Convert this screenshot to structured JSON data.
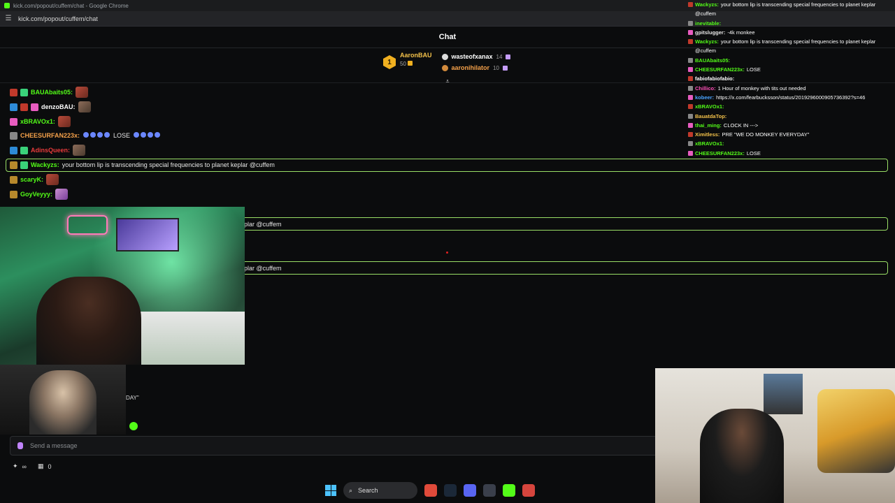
{
  "browser": {
    "title": "kick.com/popout/cuffem/chat - Google Chrome",
    "url": "kick.com/popout/cuffem/chat"
  },
  "chat": {
    "header": "Chat",
    "leaderboard": {
      "top": {
        "rank": "1",
        "name": "AaronBAU",
        "value": "50"
      },
      "others": [
        {
          "name": "wasteofxanax",
          "value": "14"
        },
        {
          "name": "aaronihilator",
          "value": "10"
        }
      ]
    },
    "messages": [
      {
        "user": "BAUAbaits05:",
        "text": "",
        "color": "#53fc18"
      },
      {
        "user": "denzoBAU:",
        "text": "",
        "color": "#ffffff"
      },
      {
        "user": "xBRAVOx1:",
        "text": "",
        "color": "#53fc18"
      },
      {
        "user": "CHEESURFAN223x:",
        "text": "LOSE",
        "color": "#f5a14a"
      },
      {
        "user": "AdinsQueen:",
        "text": "",
        "color": "#e83b3b"
      },
      {
        "user": "Wackyzs:",
        "text": "your bottom lip is transcending special frequencies to planet keplar @cuffem",
        "color": "#53fc18"
      },
      {
        "user": "scaryK:",
        "text": "",
        "color": "#53fc18"
      },
      {
        "user": "GoyVeyyy:",
        "text": "",
        "color": "#53fc18"
      }
    ],
    "partial_pinned_1": "plar @cuffem",
    "partial_pinned_2": "plar @cuffem",
    "partial_text": "DAY\"",
    "send_placeholder": "Send a message",
    "bottom": {
      "infinity": "∞",
      "count": "0"
    }
  },
  "overlay_chat": [
    {
      "user": "Wackyzs:",
      "text": "your bottom lip is transcending special frequencies to planet keplar @cuffem",
      "color": "#53fc18"
    },
    {
      "user": "inevitable:",
      "text": "",
      "color": "#53fc18"
    },
    {
      "user": "gpitslugger:",
      "text": "-4k monkee",
      "color": "#e6e6e6"
    },
    {
      "user": "Wackyzs:",
      "text": "your bottom lip is transcending special frequencies to planet keplar @cuffem",
      "color": "#53fc18"
    },
    {
      "user": "BAUAbaits05:",
      "text": "",
      "color": "#53fc18"
    },
    {
      "user": "CHEESURFAN223x:",
      "text": "LOSE",
      "color": "#53fc18"
    },
    {
      "user": "fabiofabiofabio:",
      "text": "",
      "color": "#ffffff"
    },
    {
      "user": "Chillico:",
      "text": "1 Hour of monkey with tits out needed",
      "color": "#ff4fb8"
    },
    {
      "user": "kobeer:",
      "text": "https://x.com/fearbucksson/status/2019296000905736392?s=46",
      "color": "#4aa3ff"
    },
    {
      "user": "xBRAVOx1:",
      "text": "",
      "color": "#53fc18"
    },
    {
      "user": "BauatdaTop:",
      "text": "",
      "color": "#f4c24a"
    },
    {
      "user": "thai_ming:",
      "text": "CLOCK IN --->",
      "color": "#53fc18"
    },
    {
      "user": "Ximitless:",
      "text": "PRE \"WE DO MONKEY EVERYDAY\"",
      "color": "#f4c24a"
    },
    {
      "user": "xBRAVOx1:",
      "text": "",
      "color": "#53fc18"
    },
    {
      "user": "CHEESURFAN223x:",
      "text": "LOSE",
      "color": "#53fc18"
    }
  ],
  "taskbar": {
    "search_label": "Search"
  },
  "icons": {
    "mic": "mic-icon",
    "tune": "tune-icon",
    "windows": "windows-icon",
    "search": "search-icon"
  }
}
